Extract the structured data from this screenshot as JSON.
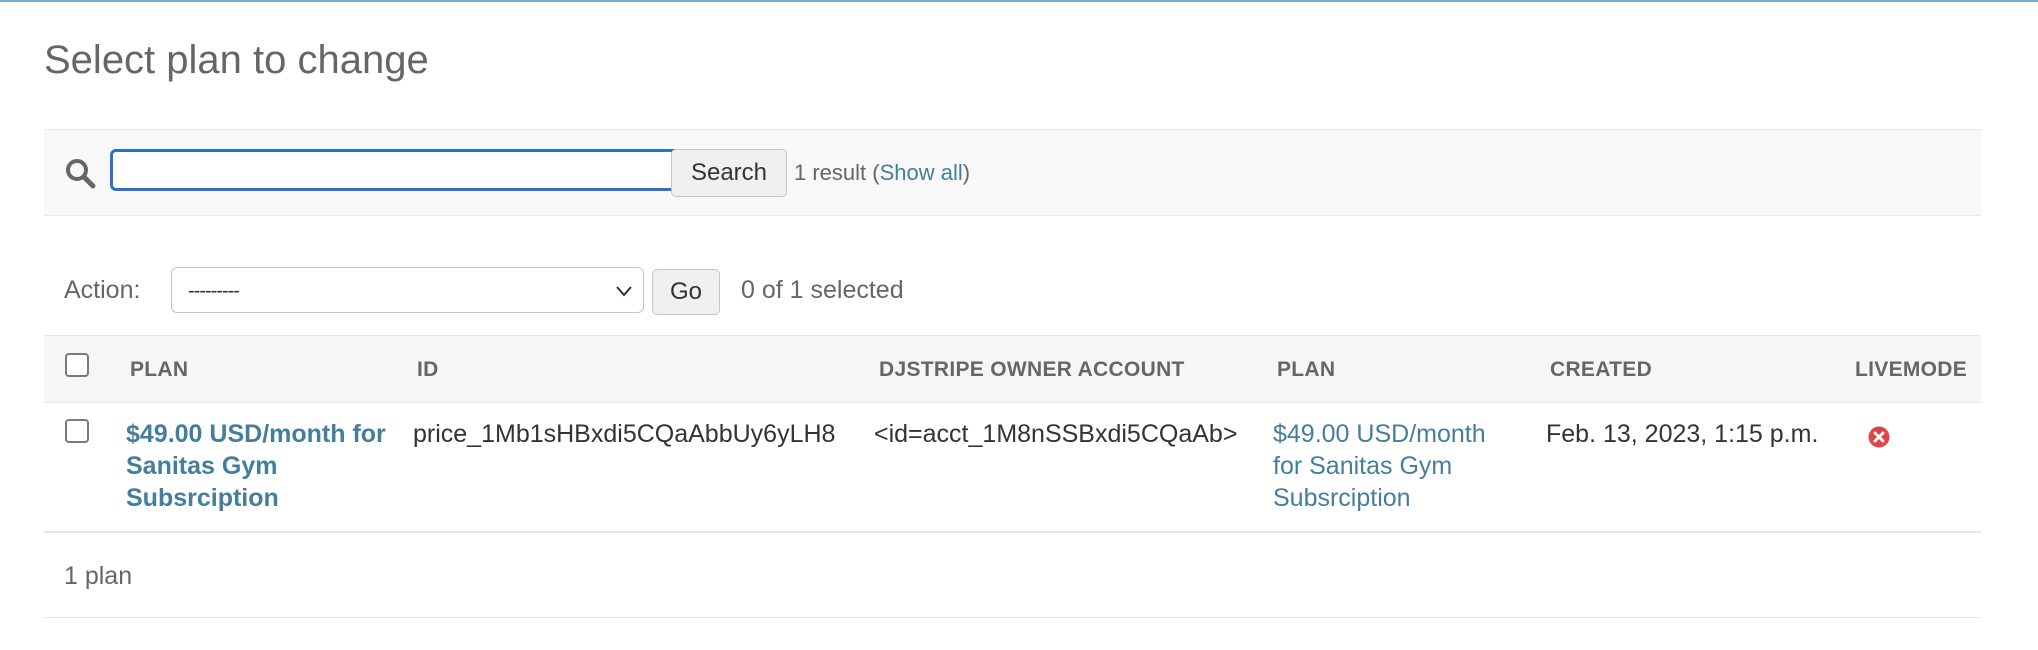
{
  "page": {
    "title": "Select plan to change"
  },
  "search": {
    "placeholder": "",
    "value": "",
    "button_label": "Search",
    "result_count": "1 result",
    "show_all": "Show all"
  },
  "actions": {
    "label": "Action:",
    "selected_option": "---------",
    "go_label": "Go",
    "selected_count": "0 of 1 selected"
  },
  "table": {
    "headers": [
      "PLAN",
      "ID",
      "DJSTRIPE OWNER ACCOUNT",
      "PLAN",
      "CREATED",
      "LIVEMODE"
    ],
    "rows": [
      {
        "plan": "$49.00 USD/month for Sanitas Gym Subsrciption",
        "id": "price_1Mb1sHBxdi5CQaAbbUy6yLH8",
        "owner_account": "<id=acct_1M8nSSBxdi5CQaAb>",
        "plan_link": "$49.00 USD/month for Sanitas Gym Subsrciption",
        "created": "Feb. 13, 2023, 1:15 p.m.",
        "livemode_icon": "false-icon"
      }
    ]
  },
  "footer": {
    "count": "1 plan"
  },
  "colors": {
    "link": "#447e9b",
    "focus_border": "#2f6fc7",
    "false_icon": "#dd4646"
  }
}
